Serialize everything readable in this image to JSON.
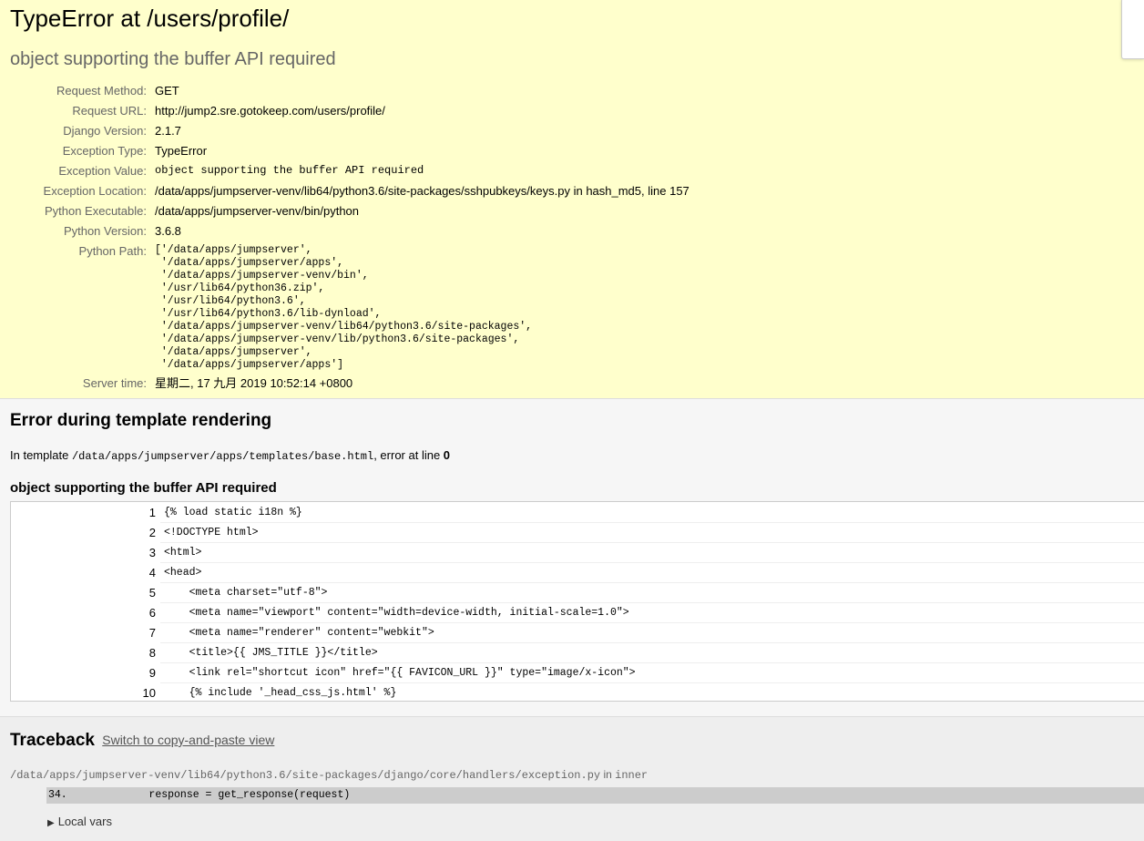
{
  "summary": {
    "title": "TypeError at /users/profile/",
    "message": "object supporting the buffer API required",
    "meta": [
      {
        "label": "Request Method:",
        "value": "GET",
        "mono": false
      },
      {
        "label": "Request URL:",
        "value": "http://jump2.sre.gotokeep.com/users/profile/",
        "mono": false
      },
      {
        "label": "Django Version:",
        "value": "2.1.7",
        "mono": false
      },
      {
        "label": "Exception Type:",
        "value": "TypeError",
        "mono": false
      },
      {
        "label": "Exception Value:",
        "value": "object supporting the buffer API required",
        "mono": true
      },
      {
        "label": "Exception Location:",
        "value": "/data/apps/jumpserver-venv/lib64/python3.6/site-packages/sshpubkeys/keys.py in hash_md5, line 157",
        "mono": false
      },
      {
        "label": "Python Executable:",
        "value": "/data/apps/jumpserver-venv/bin/python",
        "mono": false
      },
      {
        "label": "Python Version:",
        "value": "3.6.8",
        "mono": false
      }
    ],
    "python_path_label": "Python Path:",
    "python_path": "['/data/apps/jumpserver',\n '/data/apps/jumpserver/apps',\n '/data/apps/jumpserver-venv/bin',\n '/usr/lib64/python36.zip',\n '/usr/lib64/python3.6',\n '/usr/lib64/python3.6/lib-dynload',\n '/data/apps/jumpserver-venv/lib64/python3.6/site-packages',\n '/data/apps/jumpserver-venv/lib/python3.6/site-packages',\n '/data/apps/jumpserver',\n '/data/apps/jumpserver/apps']",
    "server_time_label": "Server time:",
    "server_time": "星期二, 17 九月 2019 10:52:14 +0800"
  },
  "template": {
    "heading": "Error during template rendering",
    "in_template_prefix": "In template ",
    "path": "/data/apps/jumpserver/apps/templates/base.html",
    "error_at": ", error at line ",
    "line": "0",
    "message": "object supporting the buffer API required",
    "source_lines": [
      {
        "num": "1",
        "code": "{% load static i18n %}"
      },
      {
        "num": "2",
        "code": "<!DOCTYPE html>"
      },
      {
        "num": "3",
        "code": "<html>"
      },
      {
        "num": "4",
        "code": "<head>"
      },
      {
        "num": "5",
        "code": "    <meta charset=\"utf-8\">"
      },
      {
        "num": "6",
        "code": "    <meta name=\"viewport\" content=\"width=device-width, initial-scale=1.0\">"
      },
      {
        "num": "7",
        "code": "    <meta name=\"renderer\" content=\"webkit\">"
      },
      {
        "num": "8",
        "code": "    <title>{{ JMS_TITLE }}</title>"
      },
      {
        "num": "9",
        "code": "    <link rel=\"shortcut icon\" href=\"{{ FAVICON_URL }}\" type=\"image/x-icon\">"
      },
      {
        "num": "10",
        "code": "    {% include '_head_css_js.html' %}"
      }
    ]
  },
  "traceback": {
    "heading": "Traceback",
    "switch_link": "Switch to copy-and-paste view",
    "frame_file": "/data/apps/jumpserver-venv/lib64/python3.6/site-packages/django/core/handlers/exception.py",
    "frame_in": " in ",
    "frame_func": "inner",
    "frame_line": "34.             response = get_response(request)",
    "local_vars": "Local vars"
  }
}
